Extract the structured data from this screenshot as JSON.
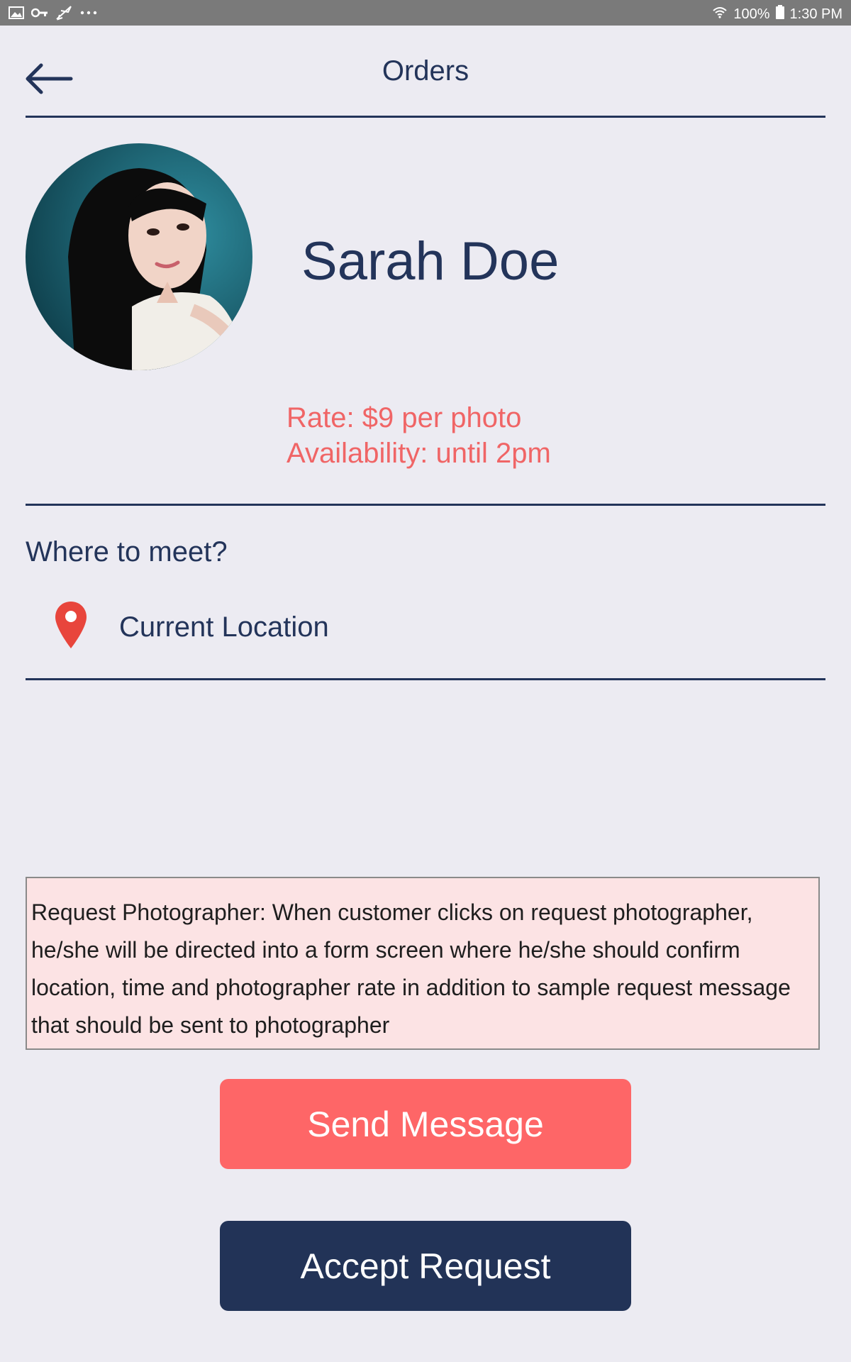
{
  "status_bar": {
    "battery": "100%",
    "time": "1:30 PM",
    "icons": [
      "image-icon",
      "key-icon",
      "airplane-icon",
      "more-dots-icon",
      "wifi-icon",
      "battery-icon"
    ]
  },
  "header": {
    "title": "Orders",
    "back_icon": "arrow-left-icon"
  },
  "profile": {
    "name": "Sarah Doe",
    "rate": "Rate: $9 per photo",
    "availability": "Availability: until 2pm"
  },
  "meet": {
    "title": "Where to meet?",
    "location_icon": "location-pin-icon",
    "location": "Current Location"
  },
  "note": {
    "text": "Request Photographer: When customer clicks on request photographer, he/she will be directed into a form screen where he/she should confirm location, time and photographer rate in addition to sample request message that should be sent to photographer"
  },
  "actions": {
    "send_message": "Send Message",
    "accept_request": "Accept Request"
  },
  "colors": {
    "navy": "#23345a",
    "coral": "#fe6667",
    "background": "#ecebf2",
    "note_bg": "#fce3e4"
  }
}
